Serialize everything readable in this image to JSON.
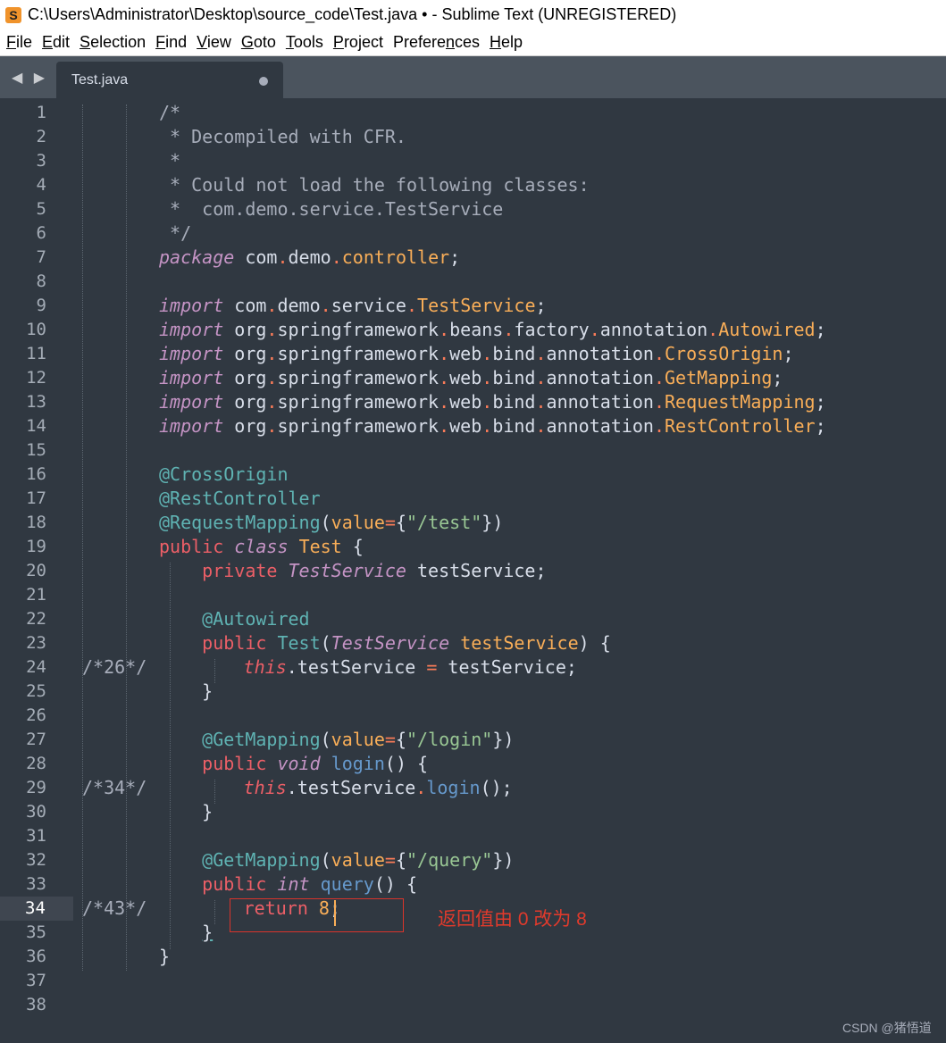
{
  "window": {
    "title": "C:\\Users\\Administrator\\Desktop\\source_code\\Test.java • - Sublime Text (UNREGISTERED)",
    "app_icon_letter": "S"
  },
  "menu": [
    {
      "label": "File",
      "key": "F",
      "rest": "ile"
    },
    {
      "label": "Edit",
      "key": "E",
      "rest": "dit"
    },
    {
      "label": "Selection",
      "key": "S",
      "rest": "election"
    },
    {
      "label": "Find",
      "key": "F",
      "rest": "ind"
    },
    {
      "label": "View",
      "key": "V",
      "rest": "iew"
    },
    {
      "label": "Goto",
      "key": "G",
      "rest": "oto"
    },
    {
      "label": "Tools",
      "key": "T",
      "rest": "ools"
    },
    {
      "label": "Project",
      "key": "P",
      "rest": "roject"
    },
    {
      "label": "Preferences",
      "key": "n",
      "pre": "Prefere",
      "rest": "ces"
    },
    {
      "label": "Help",
      "key": "H",
      "rest": "elp"
    }
  ],
  "tab": {
    "nav": "◀ ▶",
    "label": "Test.java",
    "modified": true
  },
  "editor": {
    "active_line": 34,
    "line_count": 38,
    "lines": {
      "l1": "/*",
      "l2": " * Decompiled with CFR.",
      "l3": " *",
      "l4": " * Could not load the following classes:",
      "l5": " *  com.demo.service.TestService",
      "l6": " */",
      "l24_marker": "/*26*/",
      "l29_marker": "/*34*/",
      "l34_marker": "/*43*/"
    }
  },
  "annotation": "返回值由 0 改为 8",
  "watermark": "CSDN @猪悟道"
}
